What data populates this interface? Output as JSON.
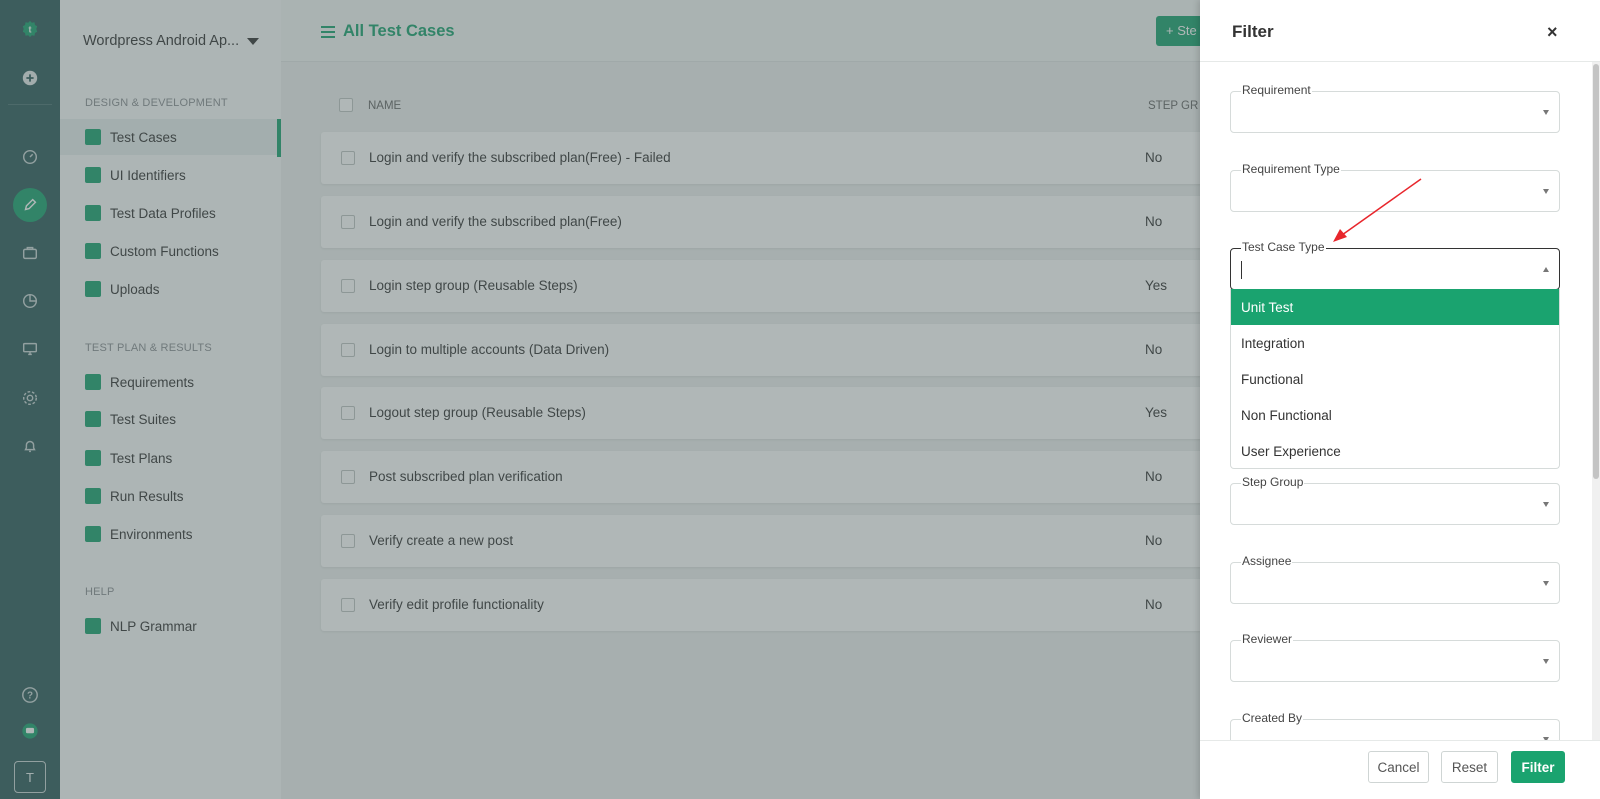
{
  "rail": {
    "avatar_letter": "T",
    "icons": [
      "logo-icon",
      "add-icon",
      "dashboard-icon",
      "edit-icon",
      "briefcase-icon",
      "pie-chart-icon",
      "monitor-icon",
      "settings-icon",
      "bell-icon",
      "help-icon",
      "chat-icon"
    ]
  },
  "sidebar": {
    "project_name": "Wordpress Android Ap...",
    "sections": [
      {
        "title": "DESIGN & DEVELOPMENT",
        "items": [
          "Test Cases",
          "UI Identifiers",
          "Test Data Profiles",
          "Custom Functions",
          "Uploads"
        ]
      },
      {
        "title": "TEST PLAN & RESULTS",
        "items": [
          "Requirements",
          "Test Suites",
          "Test Plans",
          "Run Results",
          "Environments"
        ]
      },
      {
        "title": "HELP",
        "items": [
          "NLP Grammar"
        ]
      }
    ],
    "active_item": "Test Cases"
  },
  "main": {
    "title": "All Test Cases",
    "add_button": "+ Ste",
    "columns": [
      "NAME",
      "STEP GR"
    ],
    "rows": [
      {
        "name": "Login and verify the subscribed plan(Free) - Failed",
        "step_group": "No"
      },
      {
        "name": "Login and verify the subscribed plan(Free)",
        "step_group": "No"
      },
      {
        "name": "Login step group (Reusable Steps)",
        "step_group": "Yes"
      },
      {
        "name": "Login to multiple accounts (Data Driven)",
        "step_group": "No"
      },
      {
        "name": "Logout step group (Reusable Steps)",
        "step_group": "Yes"
      },
      {
        "name": "Post subscribed plan verification",
        "step_group": "No"
      },
      {
        "name": "Verify create a new post",
        "step_group": "No"
      },
      {
        "name": "Verify edit profile functionality",
        "step_group": "No"
      }
    ]
  },
  "filter": {
    "title": "Filter",
    "close": "×",
    "fields": {
      "requirement": "Requirement",
      "requirement_type": "Requirement Type",
      "test_case_type": "Test Case Type",
      "step_group": "Step Group",
      "assignee": "Assignee",
      "reviewer": "Reviewer",
      "created_by": "Created By"
    },
    "dropdown_options": [
      "Unit Test",
      "Integration",
      "Functional",
      "Non Functional",
      "User Experience"
    ],
    "highlighted_option": "Unit Test",
    "buttons": {
      "cancel": "Cancel",
      "reset": "Reset",
      "filter": "Filter"
    }
  },
  "colors": {
    "accent": "#1aa36f",
    "rail": "#2e5b5b",
    "annotation_arrow": "#e8262c"
  }
}
